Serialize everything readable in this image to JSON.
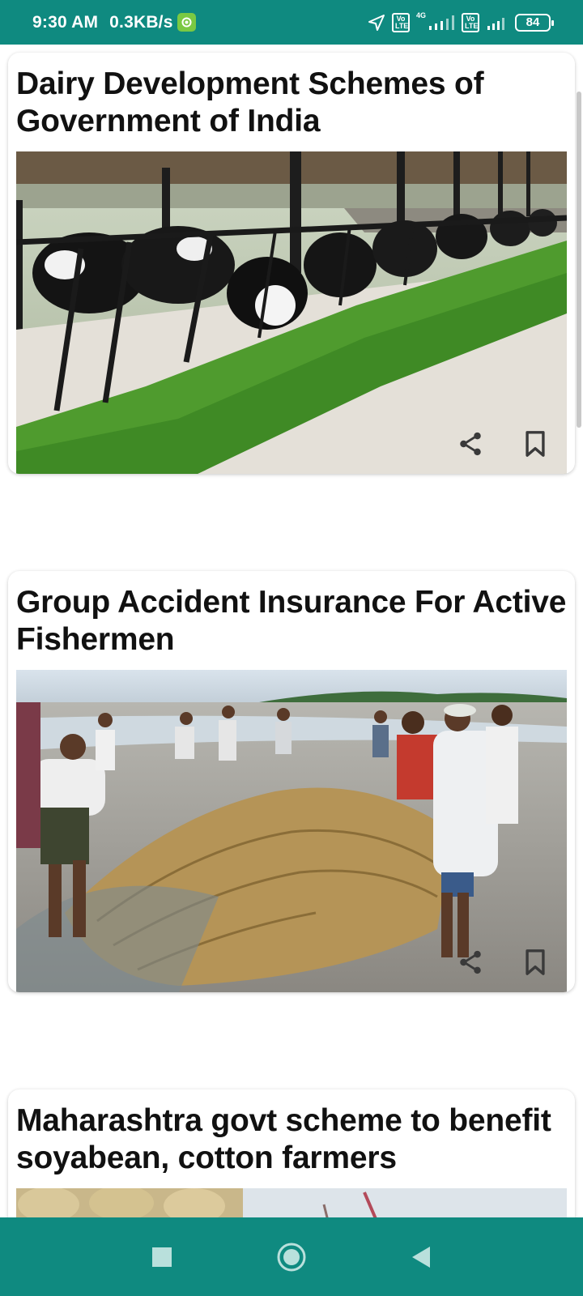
{
  "status_bar": {
    "time": "9:30 AM",
    "speed": "0.3KB/s",
    "network_tag": "4G",
    "lte_label_1": "Vo LTE",
    "lte_label_2": "Vo LTE",
    "battery": "84",
    "icons": [
      "app-notification-icon",
      "location-arrow-icon",
      "volte-icon",
      "signal-icon",
      "volte-icon",
      "signal-icon",
      "battery-icon"
    ]
  },
  "articles": [
    {
      "title": "Dairy Development Schemes of Government of India",
      "image": "cows-in-shed-photo",
      "actions": [
        "share-icon",
        "bookmark-icon"
      ]
    },
    {
      "title": "Group Accident Insurance For Active Fishermen",
      "image": "fishermen-net-photo",
      "actions": [
        "share-icon",
        "bookmark-icon"
      ]
    },
    {
      "title": "Maharashtra govt scheme to benefit soyabean, cotton farmers",
      "image": "soyabean-cotton-photo"
    }
  ],
  "nav": {
    "buttons": [
      "recents-square-icon",
      "home-circle-icon",
      "back-triangle-icon"
    ]
  },
  "colors": {
    "system_bar": "#0f8a80",
    "card_background": "#ffffff",
    "title_text": "#111111"
  }
}
